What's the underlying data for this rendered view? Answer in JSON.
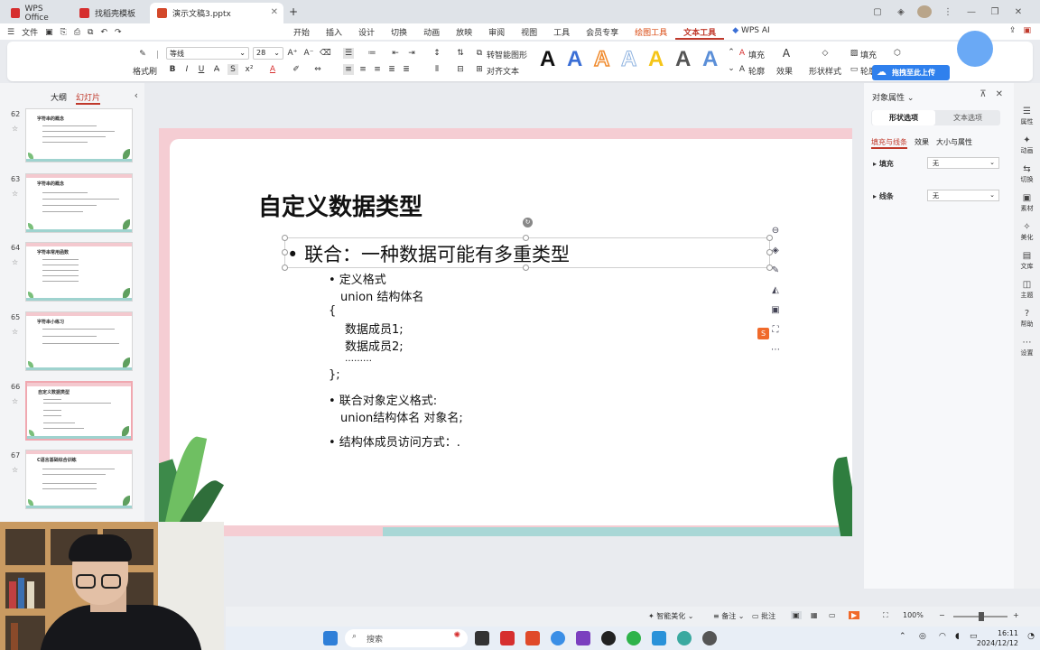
{
  "tabs": [
    {
      "label": "WPS Office",
      "color": "#d62f2f"
    },
    {
      "label": "找稻壳模板",
      "color": "#d62f2f"
    },
    {
      "label": "演示文稿3.pptx",
      "color": "#d3482a"
    }
  ],
  "menu": {
    "file_label": "文件",
    "items": [
      "开始",
      "插入",
      "设计",
      "切换",
      "动画",
      "放映",
      "审阅",
      "视图",
      "工具",
      "会员专享",
      "绘图工具",
      "文本工具"
    ],
    "wps_ai": "WPS AI",
    "drag_upload": "拖拽至此上传"
  },
  "ribbon": {
    "format_painter": "格式刷",
    "font_name": "等线",
    "font_size": "28",
    "smart_shape": "转智能图形",
    "align_text": "对齐文本",
    "fill": "填充",
    "outline": "轮廓",
    "effect": "效果",
    "shape_style": "形状样式",
    "fill2": "填充",
    "outline2": "轮廓",
    "wordart_letter": "A",
    "wordart_colors": [
      "#111111",
      "#3b6fd6",
      "#f08a2c",
      "#8fb3e0",
      "#f5c518",
      "#555555",
      "#5b8fd8"
    ]
  },
  "left_panel": {
    "tab_outline": "大纲",
    "tab_slides": "幻灯片",
    "slides": [
      {
        "num": "62",
        "title": "字符串的概念"
      },
      {
        "num": "63",
        "title": "字符串的概念"
      },
      {
        "num": "64",
        "title": "字符串常用函数"
      },
      {
        "num": "65",
        "title": "字符串小练习"
      },
      {
        "num": "66",
        "title": "自定义数据类型"
      },
      {
        "num": "67",
        "title": "C语言基础综合训练"
      }
    ]
  },
  "slide": {
    "title": "自定义数据类型",
    "main_bullet": "联合：一种数据可能有多重类型",
    "lines": [
      "•   定义格式",
      "union 结构体名",
      "{",
      "数据成员1;",
      "数据成员2;",
      "………",
      "};",
      "•   联合对象定义格式:",
      "union结构体名 对象名;",
      "•   结构体成员访问方式：."
    ]
  },
  "right_panel": {
    "title": "对象属性",
    "seg_shape": "形状选项",
    "seg_text": "文本选项",
    "subtab_fill": "填充与线条",
    "subtab_effect": "效果",
    "subtab_size": "大小与属性",
    "fill_label": "填充",
    "fill_value": "无",
    "line_label": "线条",
    "line_value": "无"
  },
  "sidebar": [
    "属性",
    "动画",
    "切换",
    "素材",
    "美化",
    "文库",
    "主题",
    "帮助",
    "设置"
  ],
  "status": {
    "smart_beautify": "智能美化",
    "notes": "备注",
    "comments": "批注",
    "zoom": "100%"
  },
  "taskbar": {
    "search_placeholder": "搜索",
    "time": "16:11",
    "date": "2024/12/12"
  }
}
